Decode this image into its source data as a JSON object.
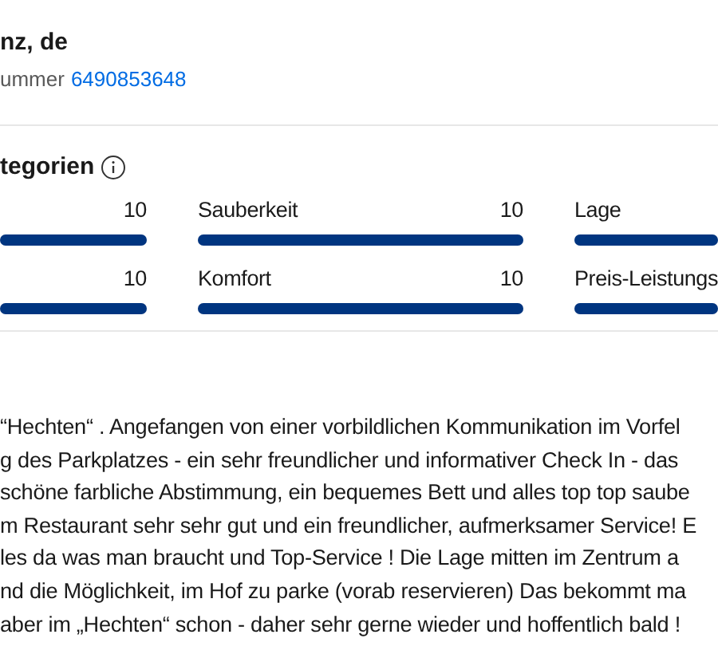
{
  "header": {
    "title": "nz, de",
    "number_label": "ummer",
    "number_link": "6490853648"
  },
  "categories": {
    "title": "tegorien",
    "items": [
      {
        "value": "10",
        "level": 1
      },
      {
        "label": "Sauberkeit",
        "value": "10",
        "level": 1
      },
      {
        "label": "Lage",
        "level": 1
      },
      {
        "value": "10",
        "level": 1
      },
      {
        "label": "Komfort",
        "value": "10",
        "level": 1
      },
      {
        "label": "Preis-Leistungs",
        "level": 1
      }
    ]
  },
  "review": {
    "lines": [
      "“Hechten“ . Angefangen von einer vorbildlichen Kommunikation im Vorfel",
      "g des Parkplatzes - ein sehr freundlicher und informativer Check In - das",
      "schöne farbliche Abstimmung, ein bequemes Bett und alles top top saube",
      "m Restaurant sehr sehr gut und ein freundlicher, aufmerksamer Service! E",
      "les da was man braucht und Top-Service !  Die Lage mitten im Zentrum a",
      "nd die Möglichkeit, im Hof zu parke (vorab reservieren)  Das bekommt ma",
      "aber im „Hechten“ schon - daher sehr gerne wieder und hoffentlich bald !"
    ]
  }
}
